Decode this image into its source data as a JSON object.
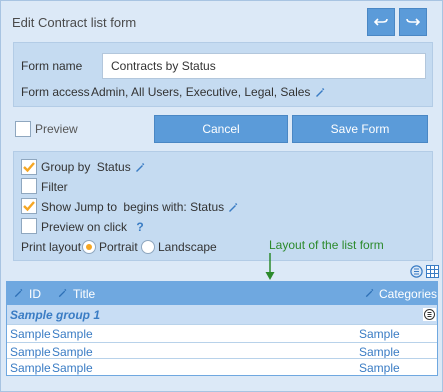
{
  "title": "Edit Contract list form",
  "header": {
    "undo_icon": "undo-icon",
    "redo_icon": "redo-icon"
  },
  "form": {
    "name_label": "Form name",
    "name_value": "Contracts by Status",
    "access_label": "Form access",
    "access_value": "Admin, All Users, Executive, Legal, Sales"
  },
  "actions": {
    "preview_label": "Preview",
    "preview_checked": false,
    "cancel_label": "Cancel",
    "save_label": "Save Form"
  },
  "options": {
    "group_by_label": "Group by",
    "group_by_value": "Status",
    "group_by_checked": true,
    "filter_label": "Filter",
    "filter_checked": false,
    "show_jump_label": "Show Jump to",
    "show_jump_value": "begins with: Status",
    "show_jump_checked": true,
    "preview_click_label": "Preview on click",
    "preview_click_checked": false,
    "help_symbol": "?",
    "print_layout_label": "Print layout",
    "portrait_label": "Portrait",
    "landscape_label": "Landscape",
    "print_layout_selected": "Portrait"
  },
  "annotation": {
    "text": "Layout of the list form",
    "color": "#2c8a2c"
  },
  "table": {
    "columns": [
      "ID",
      "Title",
      "Categories"
    ],
    "group_label": "Sample group 1",
    "rows": [
      [
        "Sample",
        "Sample",
        "Sample"
      ],
      [
        "Sample",
        "Sample",
        "Sample"
      ],
      [
        "Sample",
        "Sample",
        "Sample"
      ]
    ]
  },
  "colors": {
    "accent": "#5b9bd9",
    "background": "#dce9f7",
    "panel": "#c5dbf1",
    "check": "#f5a623",
    "table_header": "#6fa8e0"
  }
}
